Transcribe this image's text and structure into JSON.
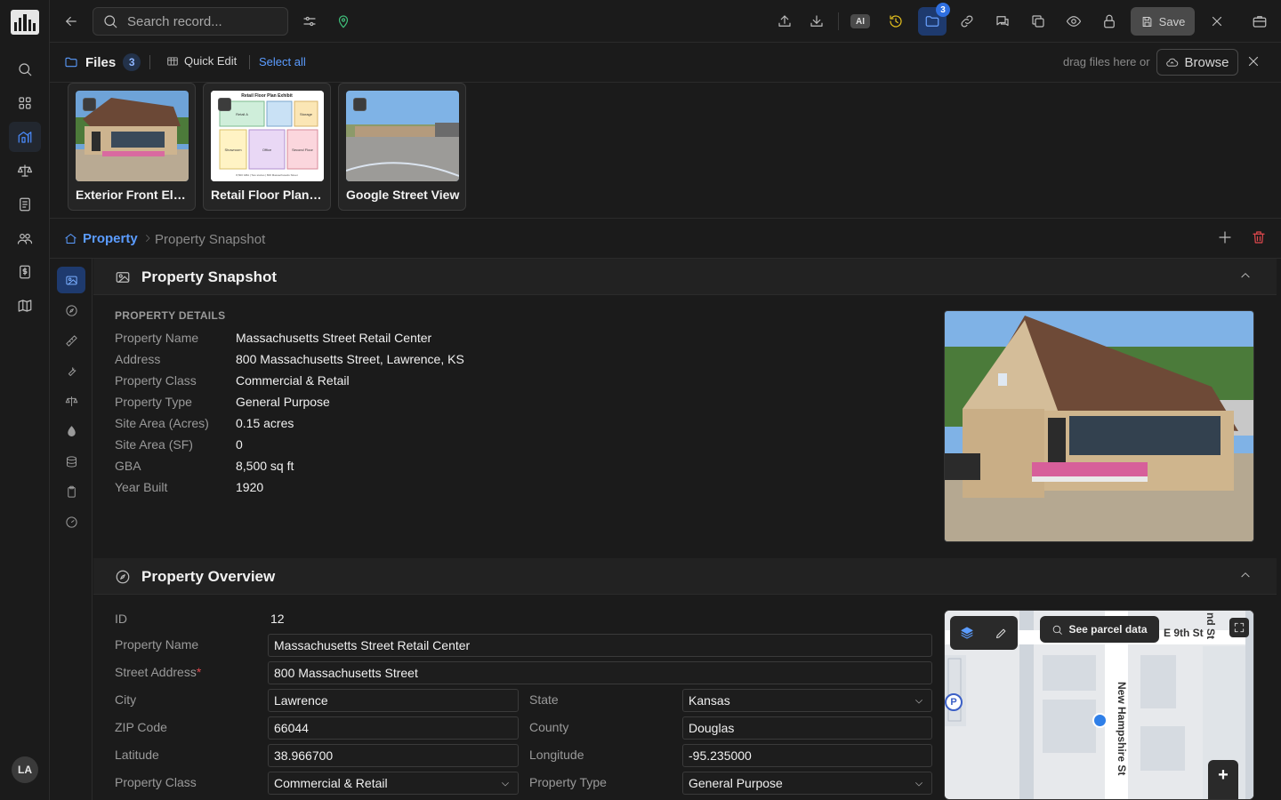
{
  "rail": {
    "avatar_initials": "LA",
    "items": [
      "search-icon",
      "apps-icon",
      "property-icon",
      "scale-icon",
      "notes-icon",
      "people-icon",
      "finance-icon",
      "map-icon"
    ]
  },
  "topbar": {
    "search_placeholder": "Search record...",
    "ai_label": "AI",
    "files_count": "3",
    "save_label": "Save"
  },
  "files": {
    "title": "Files",
    "count": "3",
    "quick_edit": "Quick Edit",
    "select_all": "Select all",
    "drag_hint": "drag files here or",
    "browse": "Browse",
    "items": [
      {
        "name": "Exterior Front Elevation"
      },
      {
        "name": "Retail Floor Plan Exhibit"
      },
      {
        "name": "Google Street View"
      }
    ],
    "floor_plan_thumb": {
      "title": "Retail Floor Plan Exhibit",
      "rooms": [
        "Retail A",
        "Storage",
        "Showroom",
        "Office",
        "Second Floor"
      ],
      "footer": "8,500 GBA | Two stories | 800 Massachusetts Street"
    }
  },
  "breadcrumb": {
    "home": "Property",
    "current": "Property Snapshot"
  },
  "snapshot": {
    "title": "Property Snapshot",
    "details_label": "PROPERTY DETAILS",
    "rows": [
      {
        "k": "Property Name",
        "v": "Massachusetts Street Retail Center"
      },
      {
        "k": "Address",
        "v": "800 Massachusetts Street, Lawrence, KS"
      },
      {
        "k": "Property Class",
        "v": "Commercial & Retail"
      },
      {
        "k": "Property Type",
        "v": "General Purpose"
      },
      {
        "k": "Site Area (Acres)",
        "v": "0.15 acres"
      },
      {
        "k": "Site Area (SF)",
        "v": "0"
      },
      {
        "k": "GBA",
        "v": "8,500 sq ft"
      },
      {
        "k": "Year Built",
        "v": "1920"
      }
    ]
  },
  "overview": {
    "title": "Property Overview",
    "id_label": "ID",
    "id_value": "12",
    "property_name_label": "Property Name",
    "property_name": "Massachusetts Street Retail Center",
    "street_label": "Street Address",
    "street_required": "*",
    "street": "800 Massachusetts Street",
    "city_label": "City",
    "city": "Lawrence",
    "state_label": "State",
    "state": "Kansas",
    "zip_label": "ZIP Code",
    "zip": "66044",
    "county_label": "County",
    "county": "Douglas",
    "lat_label": "Latitude",
    "lat": "38.966700",
    "lng_label": "Longitude",
    "lng": "-95.235000",
    "class_label": "Property Class",
    "class": "Commercial & Retail",
    "type_label": "Property Type",
    "type": "General Purpose"
  },
  "map": {
    "parcel_button": "See parcel data",
    "street_1": "E 9th St",
    "street_2": "New Hampshire St",
    "street_3": "nd St",
    "marker_p": "P",
    "zoom_in": "+"
  }
}
